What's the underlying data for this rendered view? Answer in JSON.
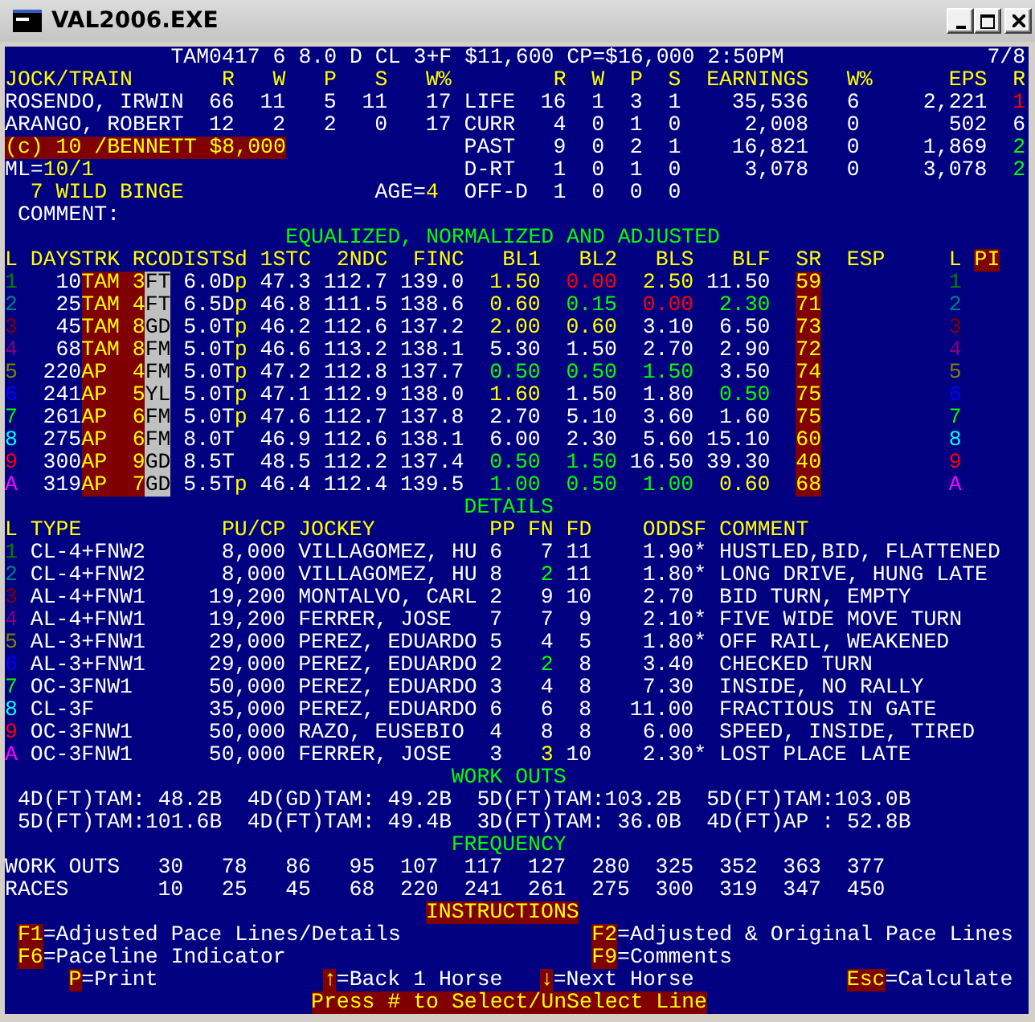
{
  "window": {
    "title": "VAL2006.EXE"
  },
  "race_header": {
    "info": "TAM0417 6 8.0 D CL 3+F $11,600 CP=$16,000 2:50PM",
    "page": "7/8"
  },
  "connections": {
    "columns": [
      "JOCK/TRAIN",
      "R",
      "W",
      "P",
      "S",
      "W%"
    ],
    "rows": [
      {
        "name": "ROSENDO, IRWIN",
        "r": "66",
        "w": "11",
        "p": "5",
        "s": "11",
        "win_pct": "17"
      },
      {
        "name": "ARANGO, ROBERT",
        "r": "12",
        "w": "2",
        "p": "2",
        "s": "0",
        "win_pct": "17"
      }
    ]
  },
  "record": {
    "columns": [
      "R",
      "W",
      "P",
      "S",
      "EARNINGS",
      "W%",
      "EPS",
      "R"
    ],
    "rows": [
      {
        "label": "LIFE",
        "r": "16",
        "w": "1",
        "p": "3",
        "s": "1",
        "earnings": "35,536",
        "win_pct": "6",
        "eps": "2,221",
        "column_9": "1",
        "color": "#ff0000"
      },
      {
        "label": "CURR",
        "r": "4",
        "w": "0",
        "p": "1",
        "s": "0",
        "earnings": "2,008",
        "win_pct": "0",
        "eps": "502",
        "column_9": "6",
        "color": "#ffffff"
      },
      {
        "label": "PAST",
        "r": "9",
        "w": "0",
        "p": "2",
        "s": "1",
        "earnings": "16,821",
        "win_pct": "0",
        "eps": "1,869",
        "column_9": "2",
        "color": "#00ff00"
      },
      {
        "label": "D-RT",
        "r": "1",
        "w": "0",
        "p": "1",
        "s": "0",
        "earnings": "3,078",
        "win_pct": "0",
        "eps": "3,078",
        "column_9": "2",
        "color": "#00ff00"
      },
      {
        "label": "OFF-D",
        "r": "1",
        "w": "0",
        "p": "0",
        "s": "0"
      }
    ]
  },
  "claim": "(c) 10 /BENNETT $8,000",
  "morning_line": {
    "label": "ML=",
    "value": "10/1"
  },
  "horse": {
    "name": "7 WILD BINGE",
    "age_label": "AGE=",
    "age": "4"
  },
  "comment_label": "COMMENT:",
  "pace_lines": {
    "title": "EQUALIZED, NORMALIZED AND ADJUSTED",
    "columns": [
      {
        "label": "L",
        "highlighted": false
      },
      {
        "label": "DAYSTRK",
        "highlighted": false
      },
      {
        "label": "RCODISTSd",
        "highlighted": false
      },
      {
        "label": "1STC",
        "highlighted": false
      },
      {
        "label": "2NDC",
        "highlighted": false
      },
      {
        "label": "FINC",
        "highlighted": false
      },
      {
        "label": "BL1",
        "highlighted": false
      },
      {
        "label": "BL2",
        "highlighted": false
      },
      {
        "label": "BLS",
        "highlighted": false
      },
      {
        "label": "BLF",
        "highlighted": false
      },
      {
        "label": "SR",
        "highlighted": false
      },
      {
        "label": "ESP",
        "highlighted": false
      },
      {
        "label": "L",
        "highlighted": false
      },
      {
        "label": "PI",
        "highlighted": true
      }
    ],
    "rows": [
      {
        "line": "1",
        "color": "#008000",
        "days": "10",
        "track": "TAM",
        "race_class": "3",
        "surface": "FT",
        "distance": "6.0D",
        "suffix": "p",
        "first_call": "47.3",
        "second_call": "112.7",
        "final": "139.0",
        "bl1": {
          "value": "1.50",
          "color": "#ffff00"
        },
        "bl2": {
          "value": "0.00",
          "color": "#ff0000"
        },
        "bls": {
          "value": "2.50",
          "color": "#ffff00"
        },
        "blf": {
          "value": "11.50",
          "color": "#ffffff"
        },
        "sr": "59",
        "line_2": "1"
      },
      {
        "line": "2",
        "color": "#008080",
        "days": "25",
        "track": "TAM",
        "race_class": "4",
        "surface": "FT",
        "distance": "6.5D",
        "suffix": "p",
        "first_call": "46.8",
        "second_call": "111.5",
        "final": "138.6",
        "bl1": {
          "value": "0.60",
          "color": "#ffff00"
        },
        "bl2": {
          "value": "0.15",
          "color": "#00ff00"
        },
        "bls": {
          "value": "0.00",
          "color": "#ff0000"
        },
        "blf": {
          "value": "2.30",
          "color": "#00ff00"
        },
        "sr": "71",
        "line_2": "2"
      },
      {
        "line": "3",
        "color": "#800000",
        "days": "45",
        "track": "TAM",
        "race_class": "8",
        "surface": "GD",
        "distance": "5.0T",
        "suffix": "p",
        "first_call": "46.2",
        "second_call": "112.6",
        "final": "137.2",
        "bl1": {
          "value": "2.00",
          "color": "#ffff00"
        },
        "bl2": {
          "value": "0.60",
          "color": "#ffff00"
        },
        "bls": {
          "value": "3.10",
          "color": "#ffffff"
        },
        "blf": {
          "value": "6.50",
          "color": "#ffffff"
        },
        "sr": "73",
        "line_2": "3"
      },
      {
        "line": "4",
        "color": "#800080",
        "days": "68",
        "track": "TAM",
        "race_class": "8",
        "surface": "FM",
        "distance": "5.0T",
        "suffix": "p",
        "first_call": "46.6",
        "second_call": "113.2",
        "final": "138.1",
        "bl1": {
          "value": "5.30",
          "color": "#ffffff"
        },
        "bl2": {
          "value": "1.50",
          "color": "#ffffff"
        },
        "bls": {
          "value": "2.70",
          "color": "#ffffff"
        },
        "blf": {
          "value": "2.90",
          "color": "#ffffff"
        },
        "sr": "72",
        "line_2": "4"
      },
      {
        "line": "5",
        "color": "#808000",
        "days": "220",
        "track": "AP",
        "race_class": "4",
        "surface": "FM",
        "distance": "5.0T",
        "suffix": "p",
        "first_call": "47.2",
        "second_call": "112.8",
        "final": "137.7",
        "bl1": {
          "value": "0.50",
          "color": "#00ff00"
        },
        "bl2": {
          "value": "0.50",
          "color": "#00ff00"
        },
        "bls": {
          "value": "1.50",
          "color": "#00ff00"
        },
        "blf": {
          "value": "3.50",
          "color": "#ffffff"
        },
        "sr": "74",
        "line_2": "5"
      },
      {
        "line": "6",
        "color": "#0000ff",
        "days": "241",
        "track": "AP",
        "race_class": "5",
        "surface": "YL",
        "distance": "5.0T",
        "suffix": "p",
        "first_call": "47.1",
        "second_call": "112.9",
        "final": "138.0",
        "bl1": {
          "value": "1.60",
          "color": "#ffff00"
        },
        "bl2": {
          "value": "1.50",
          "color": "#ffffff"
        },
        "bls": {
          "value": "1.80",
          "color": "#ffffff"
        },
        "blf": {
          "value": "0.50",
          "color": "#00ff00"
        },
        "sr": "75",
        "line_2": "6"
      },
      {
        "line": "7",
        "color": "#00ff00",
        "days": "261",
        "track": "AP",
        "race_class": "6",
        "surface": "FM",
        "distance": "5.0T",
        "suffix": "p",
        "first_call": "47.6",
        "second_call": "112.7",
        "final": "137.8",
        "bl1": {
          "value": "2.70",
          "color": "#ffffff"
        },
        "bl2": {
          "value": "5.10",
          "color": "#ffffff"
        },
        "bls": {
          "value": "3.60",
          "color": "#ffffff"
        },
        "blf": {
          "value": "1.60",
          "color": "#ffffff"
        },
        "sr": "75",
        "line_2": "7"
      },
      {
        "line": "8",
        "color": "#00ffff",
        "days": "275",
        "track": "AP",
        "race_class": "6",
        "surface": "FM",
        "distance": "8.0T",
        "first_call": "46.9",
        "second_call": "112.6",
        "final": "138.1",
        "bl1": {
          "value": "6.00",
          "color": "#ffffff"
        },
        "bl2": {
          "value": "2.30",
          "color": "#ffffff"
        },
        "bls": {
          "value": "5.60",
          "color": "#ffffff"
        },
        "blf": {
          "value": "15.10",
          "color": "#ffffff"
        },
        "sr": "60",
        "line_2": "8"
      },
      {
        "line": "9",
        "color": "#ff0000",
        "days": "300",
        "track": "AP",
        "race_class": "9",
        "surface": "GD",
        "distance": "8.5T",
        "first_call": "48.5",
        "second_call": "112.2",
        "final": "137.4",
        "bl1": {
          "value": "0.50",
          "color": "#00ff00"
        },
        "bl2": {
          "value": "1.50",
          "color": "#00ff00"
        },
        "bls": {
          "value": "16.50",
          "color": "#ffffff"
        },
        "blf": {
          "value": "39.30",
          "color": "#ffffff"
        },
        "sr": "40",
        "line_2": "9"
      },
      {
        "line": "A",
        "color": "#ff00ff",
        "days": "319",
        "track": "AP",
        "race_class": "7",
        "surface": "GD",
        "distance": "5.5T",
        "suffix": "p",
        "first_call": "46.4",
        "second_call": "112.4",
        "final": "139.5",
        "bl1": {
          "value": "1.00",
          "color": "#00ff00"
        },
        "bl2": {
          "value": "0.50",
          "color": "#00ff00"
        },
        "bls": {
          "value": "1.00",
          "color": "#00ff00"
        },
        "blf": {
          "value": "0.60",
          "color": "#ffff00"
        },
        "sr": "68",
        "line_2": "A"
      }
    ]
  },
  "details": {
    "title": "DETAILS",
    "columns": [
      "L",
      "TYPE",
      "PU/CP",
      "JOCKEY",
      "PP",
      "FN",
      "FD",
      "ODDSF",
      "COMMENT"
    ],
    "rows": [
      {
        "line": "1",
        "color": "#008000",
        "type": "CL-4+FNW2",
        "price": "8,000",
        "jockey": "VILLAGOMEZ, HU",
        "pp": "6",
        "fn": {
          "value": "7",
          "color": "#ffffff"
        },
        "fd": "11",
        "odds": "1.90",
        "odds_mark": "*",
        "comment": "HUSTLED,BID, FLATTENED"
      },
      {
        "line": "2",
        "color": "#008080",
        "type": "CL-4+FNW2",
        "price": "8,000",
        "jockey": "VILLAGOMEZ, HU",
        "pp": "8",
        "fn": {
          "value": "2",
          "color": "#00ff00"
        },
        "fd": "11",
        "odds": "1.80",
        "odds_mark": "*",
        "comment": "LONG DRIVE, HUNG LATE"
      },
      {
        "line": "3",
        "color": "#800000",
        "type": "AL-4+FNW1",
        "price": "19,200",
        "jockey": "MONTALVO, CARL",
        "pp": "2",
        "fn": {
          "value": "9",
          "color": "#ffffff"
        },
        "fd": "10",
        "odds": "2.70",
        "comment": "BID TURN, EMPTY"
      },
      {
        "line": "4",
        "color": "#800080",
        "type": "AL-4+FNW1",
        "price": "19,200",
        "jockey": "FERRER, JOSE",
        "pp": "7",
        "fn": {
          "value": "7",
          "color": "#ffffff"
        },
        "fd": "9",
        "odds": "2.10",
        "odds_mark": "*",
        "comment": "FIVE WIDE MOVE TURN"
      },
      {
        "line": "5",
        "color": "#808000",
        "type": "AL-3+FNW1",
        "price": "29,000",
        "jockey": "PEREZ, EDUARDO",
        "pp": "5",
        "fn": {
          "value": "4",
          "color": "#ffffff"
        },
        "fd": "5",
        "odds": "1.80",
        "odds_mark": "*",
        "comment": "OFF RAIL, WEAKENED"
      },
      {
        "line": "6",
        "color": "#0000ff",
        "type": "AL-3+FNW1",
        "price": "29,000",
        "jockey": "PEREZ, EDUARDO",
        "pp": "2",
        "fn": {
          "value": "2",
          "color": "#00ff00"
        },
        "fd": "8",
        "odds": "3.40",
        "comment": "CHECKED TURN"
      },
      {
        "line": "7",
        "color": "#00ff00",
        "type": "OC-3FNW1",
        "price": "50,000",
        "jockey": "PEREZ, EDUARDO",
        "pp": "3",
        "fn": {
          "value": "4",
          "color": "#ffffff"
        },
        "fd": "8",
        "odds": "7.30",
        "comment": "INSIDE, NO RALLY"
      },
      {
        "line": "8",
        "color": "#00ffff",
        "type": "CL-3F",
        "price": "35,000",
        "jockey": "PEREZ, EDUARDO",
        "pp": "6",
        "fn": {
          "value": "6",
          "color": "#ffffff"
        },
        "fd": "8",
        "odds": "11.00",
        "comment": "FRACTIOUS IN GATE"
      },
      {
        "line": "9",
        "color": "#ff0000",
        "type": "OC-3FNW1",
        "price": "50,000",
        "jockey": "RAZO, EUSEBIO",
        "pp": "4",
        "fn": {
          "value": "8",
          "color": "#ffffff"
        },
        "fd": "8",
        "odds": "6.00",
        "comment": "SPEED, INSIDE, TIRED"
      },
      {
        "line": "A",
        "color": "#ff00ff",
        "type": "OC-3FNW1",
        "price": "50,000",
        "jockey": "FERRER, JOSE",
        "pp": "3",
        "fn": {
          "value": "3",
          "color": "#ffff00"
        },
        "fd": "10",
        "odds": "2.30",
        "odds_mark": "*",
        "comment": "LOST PLACE LATE"
      }
    ]
  },
  "workouts": {
    "title": "WORK OUTS",
    "items": [
      "4D(FT)TAM: 48.2B",
      "4D(GD)TAM: 49.2B",
      "5D(FT)TAM:103.2B",
      "5D(FT)TAM:103.0B",
      "5D(FT)TAM:101.6B",
      "4D(FT)TAM: 49.4B",
      "3D(FT)TAM: 36.0B",
      "4D(FT)AP : 52.8B"
    ]
  },
  "frequency": {
    "title": "FREQUENCY",
    "rows": [
      {
        "label": "WORK OUTS",
        "values": [
          "30",
          "78",
          "86",
          "95",
          "107",
          "117",
          "127",
          "280",
          "325",
          "352",
          "363",
          "377"
        ]
      },
      {
        "label": "RACES",
        "values": [
          "10",
          "25",
          "45",
          "68",
          "220",
          "241",
          "261",
          "275",
          "300",
          "319",
          "347",
          "450"
        ]
      }
    ]
  },
  "instructions": {
    "title": "INSTRUCTIONS",
    "items": [
      {
        "key": "F1",
        "text": "=Adjusted Pace Lines/Details"
      },
      {
        "key": "F2",
        "text": "=Adjusted & Original Pace Lines"
      },
      {
        "key": "F6",
        "text": "=Paceline Indicator"
      },
      {
        "key": "F9",
        "text": "=Comments"
      },
      {
        "key": "P",
        "text": "=Print"
      },
      {
        "key": "↑",
        "text": "=Back 1 Horse"
      },
      {
        "key": "↓",
        "text": "=Next Horse"
      },
      {
        "key": "Esc",
        "text": "=Calculate"
      }
    ],
    "footer": "Press # to Select/UnSelect Line"
  }
}
